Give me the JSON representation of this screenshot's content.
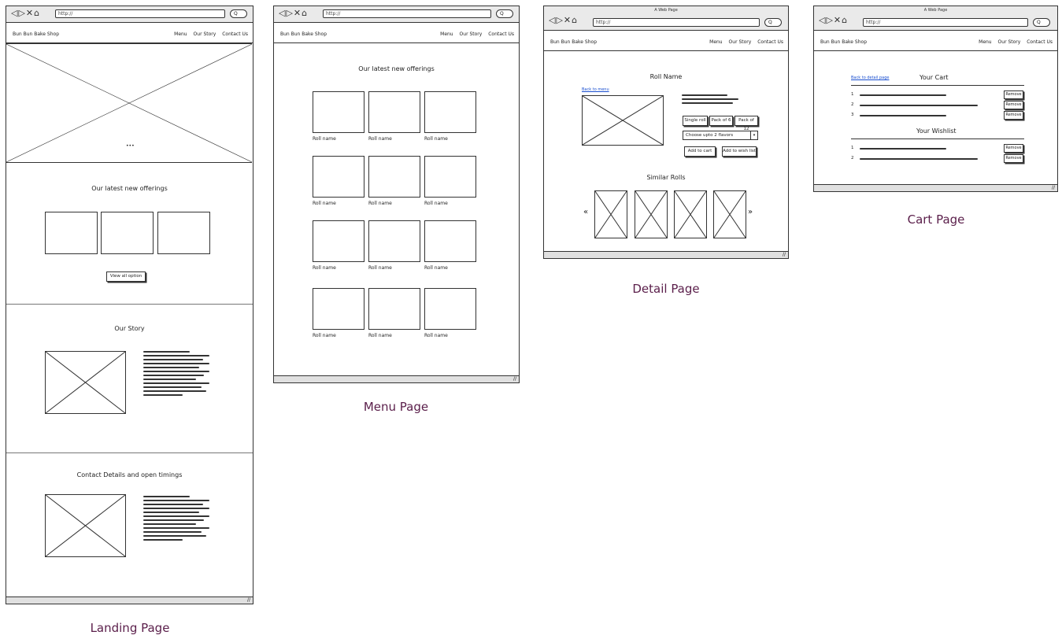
{
  "browser": {
    "url": "http://",
    "window_title": "A Web Page",
    "nav_icons": "◁▷✕⌂",
    "search_icon": "Q",
    "grip": "//"
  },
  "site": {
    "brand": "Bun Bun Bake Shop",
    "nav": [
      "Menu",
      "Our Story",
      "Contact Us"
    ]
  },
  "landing": {
    "label": "Landing Page",
    "carousel_dots": "•••",
    "offerings_title": "Our latest new offerings",
    "view_all": "View all option",
    "story_title": "Our Story",
    "contact_title": "Contact Details and open timings"
  },
  "menu": {
    "label": "Menu Page",
    "title": "Our latest new offerings",
    "item_caption": "Roll name"
  },
  "detail": {
    "label": "Detail Page",
    "title": "Roll Name",
    "back_link": "Back to menu",
    "options": [
      "Single roll",
      "Pack of 6",
      "Pack of 12"
    ],
    "select_placeholder": "Choose upto 2 flavors",
    "add_to_cart": "Add to cart",
    "add_to_wishlist": "Add to wish list",
    "similar_title": "Similar Rolls",
    "prev": "«",
    "next": "»"
  },
  "cart": {
    "label": "Cart Page",
    "back_link": "Back to detail page",
    "cart_title": "Your Cart",
    "wishlist_title": "Your Wishlist",
    "remove": "Remove",
    "cart_items": [
      "1",
      "2",
      "3"
    ],
    "wishlist_items": [
      "1",
      "2"
    ]
  }
}
